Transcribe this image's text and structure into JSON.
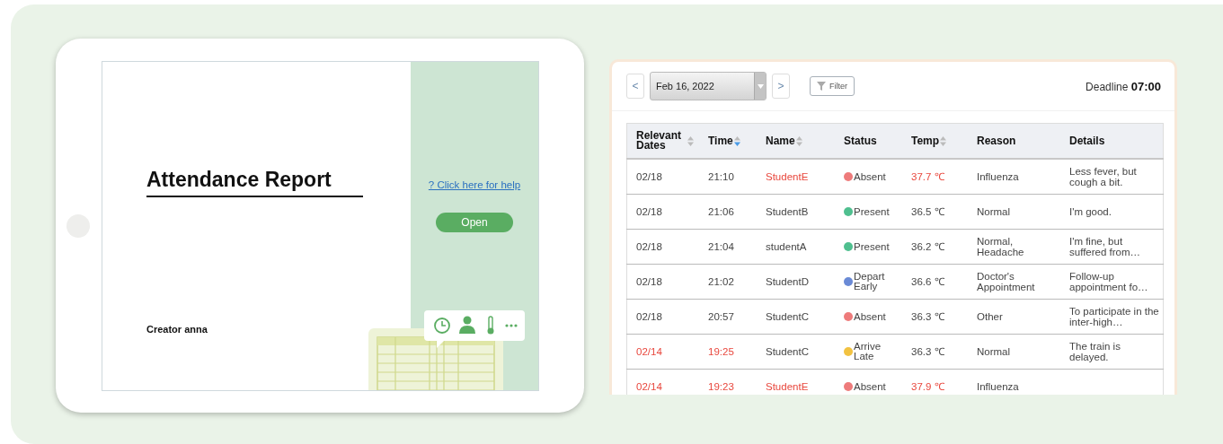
{
  "report": {
    "title": "Attendance Report",
    "creator": "Creator anna",
    "help_link": "? Click here for help",
    "open_button": "Open"
  },
  "toolbar": {
    "prev": "<",
    "date": "Feb 16, 2022",
    "next": ">",
    "filter": "Filter",
    "deadline_label": "Deadline",
    "deadline_time": "07:00"
  },
  "table": {
    "columns": [
      {
        "label": "Relevant Dates",
        "sortable": true,
        "sorted": false
      },
      {
        "label": "Time",
        "sortable": true,
        "sorted": true
      },
      {
        "label": "Name",
        "sortable": true,
        "sorted": false
      },
      {
        "label": "Status",
        "sortable": false,
        "sorted": false
      },
      {
        "label": "Temp",
        "sortable": true,
        "sorted": false
      },
      {
        "label": "Reason",
        "sortable": false,
        "sorted": false
      },
      {
        "label": "Details",
        "sortable": false,
        "sorted": false
      }
    ],
    "rows": [
      {
        "date": "02/18",
        "time": "21:10",
        "name": "StudentE",
        "status": "Absent",
        "color": "#ee7b7b",
        "temp": "37.7 ℃",
        "reason": "Influenza",
        "details": "Less fever, but cough a bit.",
        "late": false,
        "fever": true
      },
      {
        "date": "02/18",
        "time": "21:06",
        "name": "StudentB",
        "status": "Present",
        "color": "#4fbf8f",
        "temp": "36.5 ℃",
        "reason": "Normal",
        "details": "I'm good.",
        "late": false,
        "fever": false
      },
      {
        "date": "02/18",
        "time": "21:04",
        "name": "studentA",
        "status": "Present",
        "color": "#4fbf8f",
        "temp": "36.2 ℃",
        "reason": "Normal, Headache",
        "details": "I'm fine, but suffered from…",
        "late": false,
        "fever": false
      },
      {
        "date": "02/18",
        "time": "21:02",
        "name": "StudentD",
        "status": "Depart Early",
        "color": "#6a8ad6",
        "temp": "36.6 ℃",
        "reason": "Doctor's Appointment",
        "details": "Follow-up appointment fo…",
        "late": false,
        "fever": false
      },
      {
        "date": "02/18",
        "time": "20:57",
        "name": "StudentC",
        "status": "Absent",
        "color": "#ee7b7b",
        "temp": "36.3 ℃",
        "reason": "Other",
        "details": "To participate in the inter-high…",
        "late": false,
        "fever": false
      },
      {
        "date": "02/14",
        "time": "19:25",
        "name": "StudentC",
        "status": "Arrive Late",
        "color": "#f2c241",
        "temp": "36.3 ℃",
        "reason": "Normal",
        "details": "The train is delayed.",
        "late": true,
        "fever": false
      },
      {
        "date": "02/14",
        "time": "19:23",
        "name": "StudentE",
        "status": "Absent",
        "color": "#ee7b7b",
        "temp": "37.9 ℃",
        "reason": "Influenza",
        "late": true,
        "fever": true
      }
    ]
  }
}
